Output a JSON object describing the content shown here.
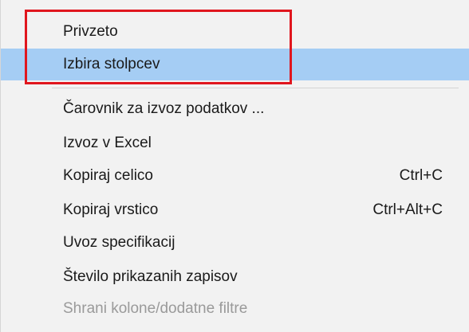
{
  "context_menu": {
    "items": [
      {
        "label": "Privzeto",
        "shortcut": ""
      },
      {
        "label": "Izbira stolpcev",
        "shortcut": "",
        "state": "hovered"
      },
      {
        "label": "Čarovnik za izvoz podatkov ...",
        "shortcut": ""
      },
      {
        "label": "Izvoz v Excel",
        "shortcut": ""
      },
      {
        "label": "Kopiraj celico",
        "shortcut": "Ctrl+C"
      },
      {
        "label": "Kopiraj vrstico",
        "shortcut": "Ctrl+Alt+C"
      },
      {
        "label": "Uvoz specifikacij",
        "shortcut": ""
      },
      {
        "label": "Število prikazanih zapisov",
        "shortcut": ""
      },
      {
        "label": "Shrani kolone/dodatne filtre",
        "shortcut": "",
        "state": "disabled"
      }
    ]
  },
  "colors": {
    "menu_background": "#f2f2f2",
    "hover_background": "#a5cdf4",
    "annotation_border": "#e0161e",
    "disabled_text": "#9a9a9a"
  }
}
